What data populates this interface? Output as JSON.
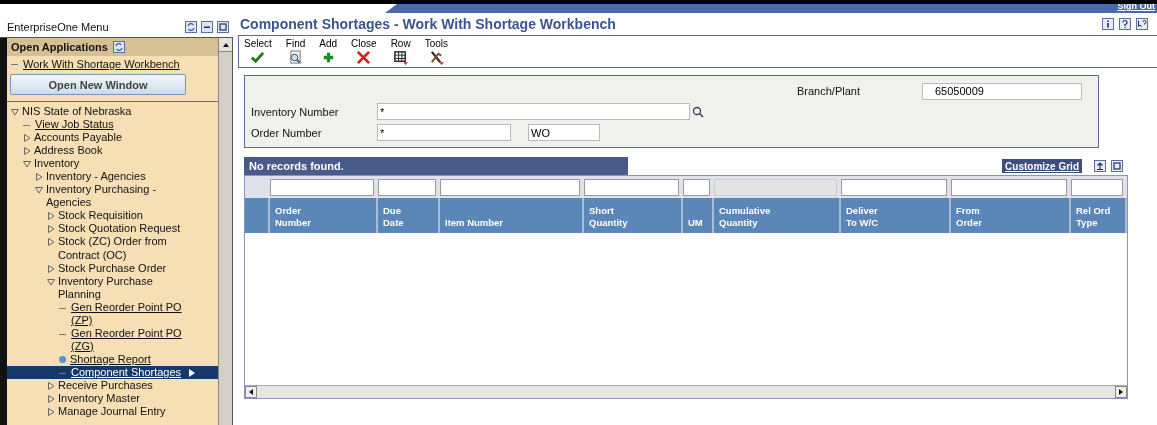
{
  "top_bar": {
    "sign_out": "Sign Out"
  },
  "sidebar": {
    "title": "EnterpriseOne Menu",
    "open_applications": {
      "title": "Open Applications",
      "items": [
        {
          "label": "Work With Shortage Workbench"
        }
      ],
      "button": "Open New Window"
    },
    "tree": [
      {
        "label": "NIS State of Nebraska",
        "kind": "folder",
        "expanded": true,
        "selected": false,
        "children": [
          {
            "label": "View Job Status",
            "kind": "task",
            "selected": false
          },
          {
            "label": "Accounts Payable",
            "kind": "folder",
            "expanded": false,
            "selected": false
          },
          {
            "label": "Address Book",
            "kind": "folder",
            "expanded": false,
            "selected": false
          },
          {
            "label": "Inventory",
            "kind": "folder",
            "expanded": true,
            "selected": false,
            "children": [
              {
                "label": "Inventory - Agencies",
                "kind": "folder",
                "expanded": false,
                "selected": false
              },
              {
                "label": "Inventory Purchasing - Agencies",
                "kind": "folder",
                "expanded": true,
                "selected": false,
                "children": [
                  {
                    "label": "Stock Requisition",
                    "kind": "folder",
                    "expanded": false,
                    "selected": false
                  },
                  {
                    "label": "Stock Quotation Request",
                    "kind": "folder",
                    "expanded": false,
                    "selected": false
                  },
                  {
                    "label": "Stock (ZC) Order from Contract (OC)",
                    "kind": "folder",
                    "expanded": false,
                    "selected": false
                  },
                  {
                    "label": "Stock Purchase Order",
                    "kind": "folder",
                    "expanded": false,
                    "selected": false
                  },
                  {
                    "label": "Inventory Purchase Planning",
                    "kind": "folder",
                    "expanded": true,
                    "selected": false,
                    "children": [
                      {
                        "label": "Gen Reorder Point PO (ZP)",
                        "kind": "task",
                        "selected": false
                      },
                      {
                        "label": "Gen Reorder Point PO (ZG)",
                        "kind": "task",
                        "selected": false
                      },
                      {
                        "label": "Shortage Report",
                        "kind": "report",
                        "selected": false
                      },
                      {
                        "label": "Component Shortages",
                        "kind": "task",
                        "selected": true
                      }
                    ]
                  },
                  {
                    "label": "Receive Purchases",
                    "kind": "folder",
                    "expanded": false,
                    "selected": false
                  },
                  {
                    "label": "Inventory Master",
                    "kind": "folder",
                    "expanded": false,
                    "selected": false
                  },
                  {
                    "label": "Manage Journal Entry",
                    "kind": "folder",
                    "expanded": false,
                    "selected": false
                  }
                ]
              }
            ]
          }
        ]
      }
    ]
  },
  "window": {
    "title": "Component Shortages - Work With Shortage Workbench"
  },
  "toolbar": [
    {
      "label": "Select",
      "kind": "select"
    },
    {
      "label": "Find",
      "kind": "find"
    },
    {
      "label": "Add",
      "kind": "add"
    },
    {
      "label": "Close",
      "kind": "close"
    },
    {
      "label": "Row",
      "kind": "row"
    },
    {
      "label": "Tools",
      "kind": "tools"
    }
  ],
  "form": {
    "branch_plant": {
      "label": "Branch/Plant",
      "value": "65050009"
    },
    "inventory_number": {
      "label": "Inventory Number",
      "value": "*"
    },
    "order_number": {
      "label": "Order Number",
      "value": "*",
      "type_value": "WO"
    }
  },
  "grid": {
    "message": "No records found.",
    "customize": "Customize Grid",
    "columns": [
      {
        "label": "Order\nNumber",
        "filter_disabled": false
      },
      {
        "label": "Due\nDate",
        "filter_disabled": false
      },
      {
        "label": "Item Number",
        "filter_disabled": false
      },
      {
        "label": "Short\nQuantity",
        "filter_disabled": false
      },
      {
        "label": "UM",
        "filter_disabled": false
      },
      {
        "label": "Cumulative\nQuantity",
        "filter_disabled": true
      },
      {
        "label": "Deliver\nTo W/C",
        "filter_disabled": false
      },
      {
        "label": "From\nOrder",
        "filter_disabled": false
      },
      {
        "label": "Rel Ord\nType",
        "filter_disabled": false
      }
    ]
  }
}
